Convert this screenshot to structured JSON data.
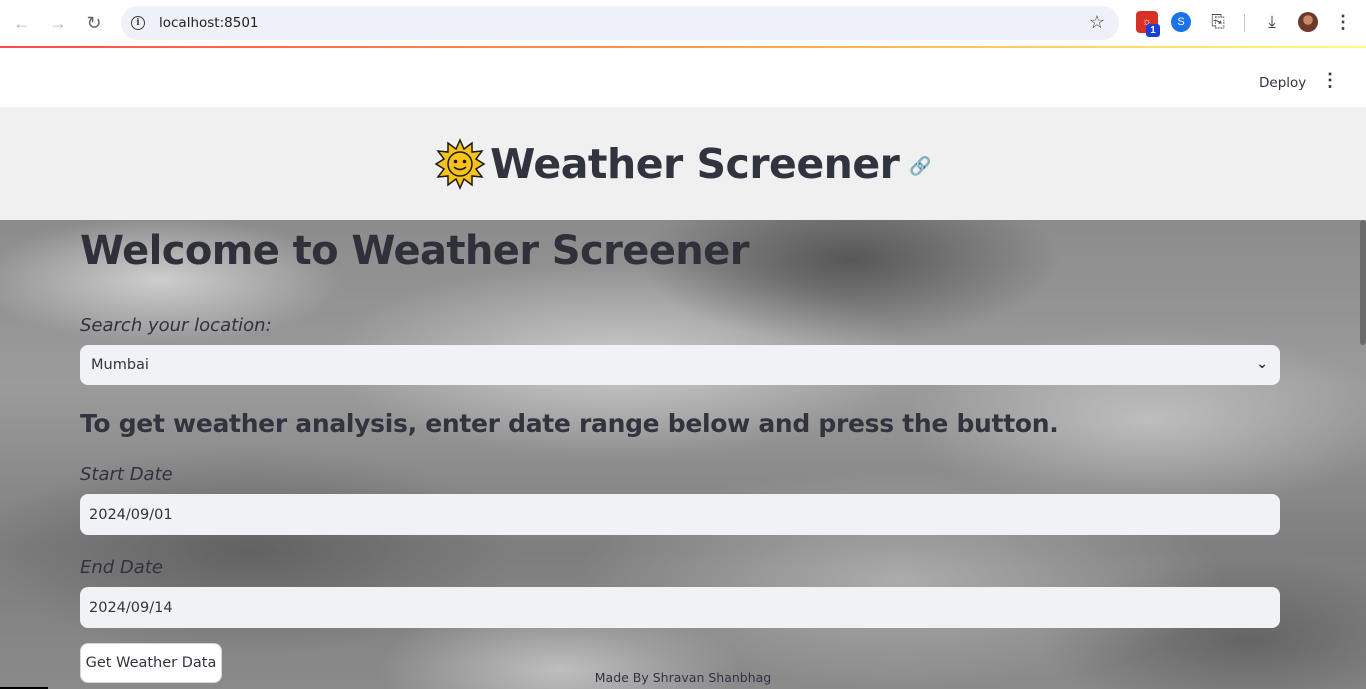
{
  "browser": {
    "url": "localhost:8501",
    "extension_badge": "1"
  },
  "header": {
    "deploy_label": "Deploy"
  },
  "app": {
    "title": "Weather Screener",
    "title_emoji": "🌞"
  },
  "main": {
    "welcome": "Welcome to Weather Screener",
    "location_label": "Search your location:",
    "location_value": "Mumbai",
    "instructions": "To get weather analysis, enter date range below and press the button.",
    "start_date_label": "Start Date",
    "start_date_value": "2024/09/01",
    "end_date_label": "End Date",
    "end_date_value": "2024/09/14",
    "button_label": "Get Weather Data",
    "footer": "Made By Shravan Shanbhag"
  },
  "colors": {
    "accent_line_start": "#ff4b4b",
    "text": "#31333f",
    "input_bg": "#f0f2f6",
    "title_band_bg": "#f0f0f0"
  }
}
